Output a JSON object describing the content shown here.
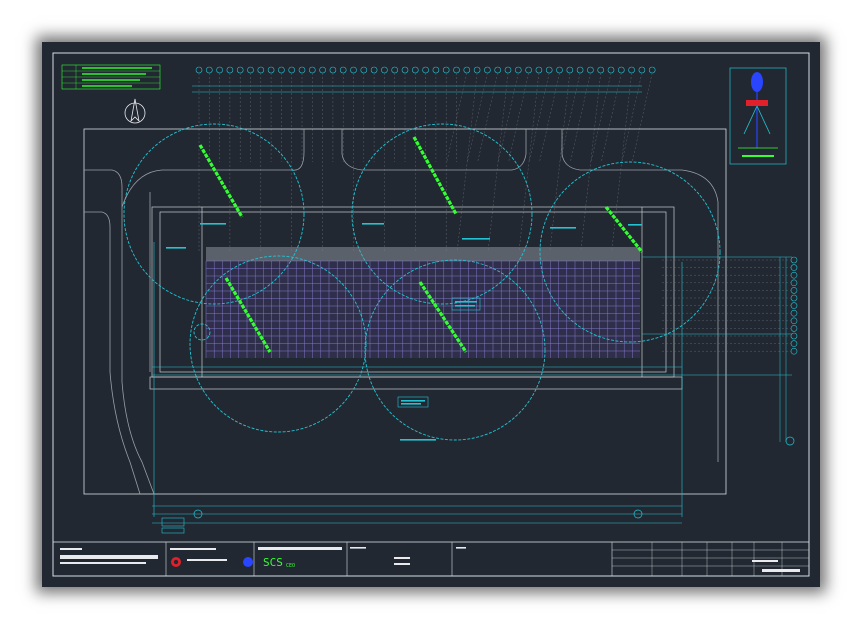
{
  "colors": {
    "background": "#222831",
    "frame": "#d8dde2",
    "cyan": "#22c4d4",
    "green": "#33ff33",
    "grid": "#8a7fd6",
    "red": "#e0202a",
    "blue": "#2a45ff",
    "white": "#e8eaee"
  },
  "titleblock": {
    "logo_text": "SCS",
    "logo_sub": "CEO"
  }
}
